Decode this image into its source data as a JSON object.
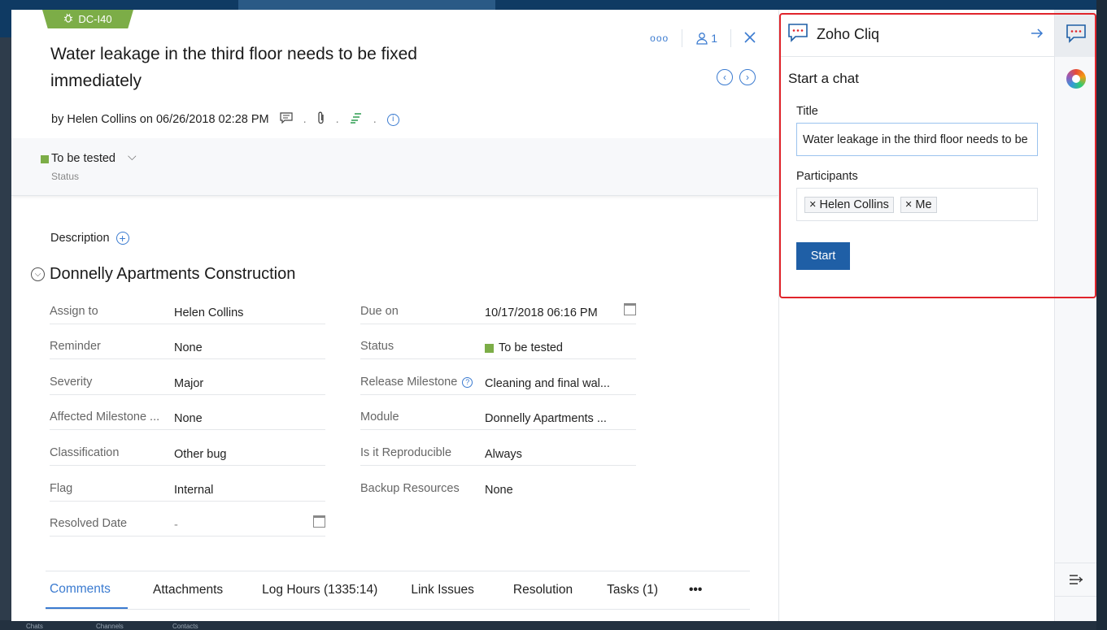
{
  "background": {
    "bottom_items": [
      "Chats",
      "Channels",
      "Contacts"
    ]
  },
  "issue": {
    "id": "DC-I40",
    "title": "Water leakage in the third floor needs to be fixed immediately",
    "followers_count": "1",
    "byline": "by Helen Collins on 06/26/2018 02:28 PM",
    "status_value": "To be tested",
    "status_label": "Status",
    "status_color": "#7cad47",
    "description_label": "Description",
    "section_title": "Donnelly Apartments Construction"
  },
  "fields_left": [
    {
      "label": "Assign to",
      "value": "Helen Collins"
    },
    {
      "label": "Reminder",
      "value": "None"
    },
    {
      "label": "Severity",
      "value": "Major"
    },
    {
      "label": "Affected Milestone ...",
      "value": "None"
    },
    {
      "label": "Classification",
      "value": "Other bug"
    },
    {
      "label": "Flag",
      "value": "Internal"
    },
    {
      "label": "Resolved Date",
      "value": "-"
    }
  ],
  "fields_right": [
    {
      "label": "Due on",
      "value": "10/17/2018 06:16 PM"
    },
    {
      "label": "Status",
      "value": "To be tested"
    },
    {
      "label": "Release Milestone",
      "value": "Cleaning and final wal..."
    },
    {
      "label": "Module",
      "value": "Donnelly Apartments ..."
    },
    {
      "label": "Is it Reproducible",
      "value": "Always"
    },
    {
      "label": "Backup Resources",
      "value": "None"
    }
  ],
  "tabs": [
    {
      "label": "Comments",
      "active": true
    },
    {
      "label": "Attachments"
    },
    {
      "label": "Log Hours (1335:14)"
    },
    {
      "label": "Link Issues"
    },
    {
      "label": "Resolution"
    },
    {
      "label": "Tasks (1)"
    },
    {
      "label": "•••"
    }
  ],
  "cliq": {
    "name": "Zoho Cliq",
    "heading": "Start a chat",
    "title_label": "Title",
    "title_value": "Water leakage in the third floor needs to be fixed immediately",
    "participants_label": "Participants",
    "participants": [
      "Helen Collins",
      "Me"
    ],
    "start_label": "Start",
    "highlight_color": "#e0242b"
  }
}
